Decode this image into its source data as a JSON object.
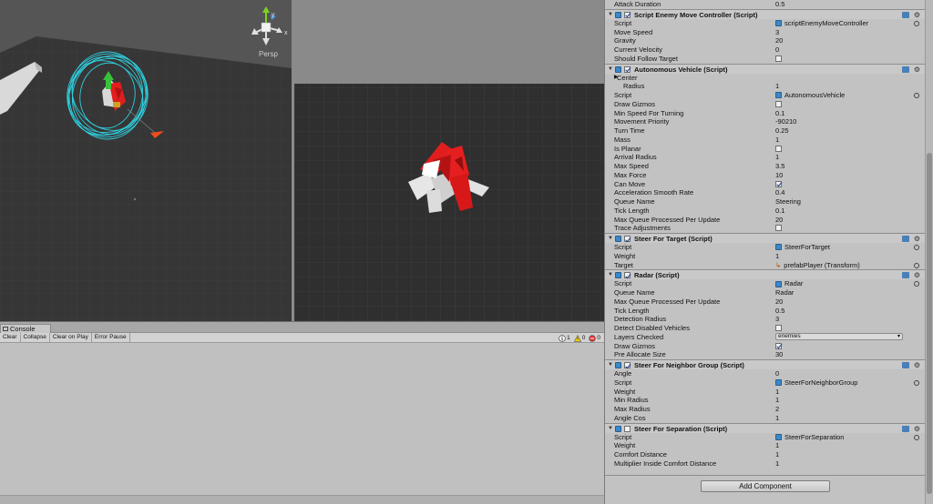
{
  "scene_view": {
    "persp_label": "Persp",
    "gizmo_axes": {
      "x": "x",
      "y": "y"
    }
  },
  "console": {
    "tab_label": "Console",
    "toolbar": {
      "clear": "Clear",
      "collapse": "Collapse",
      "clear_on_play": "Clear on Play",
      "error_pause": "Error Pause"
    },
    "counters": {
      "info": "1",
      "warnings": "0",
      "errors": "0"
    }
  },
  "inspector": {
    "top_rows": [
      {
        "label": "Attack Duration",
        "value": "0.5"
      }
    ],
    "components": [
      {
        "title": "Script Enemy Move Controller (Script)",
        "enabled": true,
        "rows": [
          {
            "label": "Script",
            "value": "scriptEnemyMoveController",
            "kind": "script"
          },
          {
            "label": "Move Speed",
            "value": "3"
          },
          {
            "label": "Gravity",
            "value": "20"
          },
          {
            "label": "Current Velocity",
            "value": "0"
          },
          {
            "label": "Should Follow Target",
            "kind": "bool",
            "checked": false
          }
        ]
      },
      {
        "title": "Autonomous Vehicle (Script)",
        "enabled": true,
        "rows": [
          {
            "label": "Center",
            "kind": "foldout"
          },
          {
            "label": "Radius",
            "value": "1",
            "indent": true
          },
          {
            "label": "Script",
            "value": "AutonomousVehicle",
            "kind": "script"
          },
          {
            "label": "Draw Gizmos",
            "kind": "bool",
            "checked": false
          },
          {
            "label": "Min Speed For Turning",
            "value": "0.1"
          },
          {
            "label": "Movement Priority",
            "value": "-90210"
          },
          {
            "label": "Turn Time",
            "value": "0.25"
          },
          {
            "label": "Mass",
            "value": "1"
          },
          {
            "label": "Is Planar",
            "kind": "bool",
            "checked": false
          },
          {
            "label": "Arrival Radius",
            "value": "1"
          },
          {
            "label": "Max Speed",
            "value": "3.5"
          },
          {
            "label": "Max Force",
            "value": "10"
          },
          {
            "label": "Can Move",
            "kind": "bool",
            "checked": true
          },
          {
            "label": "Acceleration Smooth Rate",
            "value": "0.4"
          },
          {
            "label": "Queue Name",
            "value": "Steering"
          },
          {
            "label": "Tick Length",
            "value": "0.1"
          },
          {
            "label": "Max Queue Processed Per Update",
            "value": "20"
          },
          {
            "label": "Trace Adjustments",
            "kind": "bool",
            "checked": false
          }
        ]
      },
      {
        "title": "Steer For Target (Script)",
        "enabled": true,
        "rows": [
          {
            "label": "Script",
            "value": "SteerForTarget",
            "kind": "script"
          },
          {
            "label": "Weight",
            "value": "1"
          },
          {
            "label": "Target",
            "value": "prefabPlayer (Transform)",
            "kind": "object"
          }
        ]
      },
      {
        "title": "Radar (Script)",
        "enabled": true,
        "rows": [
          {
            "label": "Script",
            "value": "Radar",
            "kind": "script"
          },
          {
            "label": "Queue Name",
            "value": "Radar"
          },
          {
            "label": "Max Queue Processed Per Update",
            "value": "20"
          },
          {
            "label": "Tick Length",
            "value": "0.5"
          },
          {
            "label": "Detection Radius",
            "value": "3"
          },
          {
            "label": "Detect Disabled Vehicles",
            "kind": "bool",
            "checked": false
          },
          {
            "label": "Layers Checked",
            "value": "enemies",
            "kind": "dropdown"
          },
          {
            "label": "Draw Gizmos",
            "kind": "bool",
            "checked": true
          },
          {
            "label": "Pre Allocate Size",
            "value": "30"
          }
        ]
      },
      {
        "title": "Steer For Neighbor Group (Script)",
        "enabled": true,
        "rows": [
          {
            "label": "Angle",
            "value": "0"
          },
          {
            "label": "Script",
            "value": "SteerForNeighborGroup",
            "kind": "script"
          },
          {
            "label": "Weight",
            "value": "1"
          },
          {
            "label": "Min Radius",
            "value": "1"
          },
          {
            "label": "Max Radius",
            "value": "2"
          },
          {
            "label": "Angle Cos",
            "value": "1"
          }
        ]
      },
      {
        "title": "Steer For Separation (Script)",
        "enabled": false,
        "rows": [
          {
            "label": "Script",
            "value": "SteerForSeparation",
            "kind": "script"
          },
          {
            "label": "Weight",
            "value": "1"
          },
          {
            "label": "Comfort Distance",
            "value": "1"
          },
          {
            "label": "Multiplier Inside Comfort Distance",
            "value": "1"
          }
        ]
      }
    ],
    "add_component_label": "Add Component"
  },
  "colors": {
    "scene_bg": "#333333",
    "game_bg": "#3a3a3a",
    "inspector_bg": "#c2c2c2",
    "gizmo_cyan": "#2fd6e6",
    "enemy_red": "#e41c1c",
    "script_blue": "#3b88c8"
  }
}
